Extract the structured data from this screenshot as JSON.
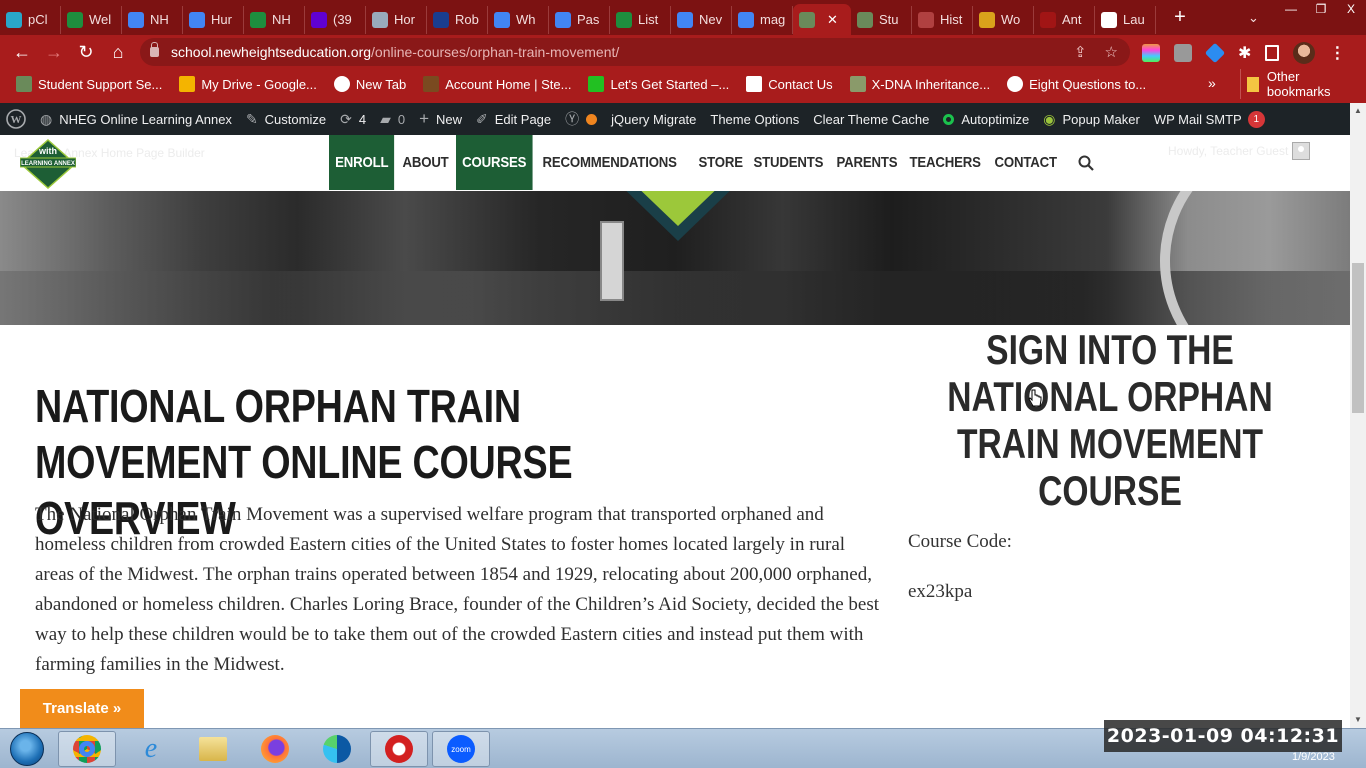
{
  "browser": {
    "tabs": [
      {
        "label": "pCl",
        "icon": "cloud-icon",
        "color": "#2aa7c9"
      },
      {
        "label": "Wel",
        "icon": "google-sheets-icon",
        "color": "#1e8e3e"
      },
      {
        "label": "NH",
        "icon": "google-docs-icon",
        "color": "#4285f4"
      },
      {
        "label": "Hur",
        "icon": "google-docs-icon",
        "color": "#4285f4"
      },
      {
        "label": "NH",
        "icon": "google-sheets-icon",
        "color": "#1e8e3e"
      },
      {
        "label": "(39",
        "icon": "yahoo-mail-icon",
        "color": "#6001d2"
      },
      {
        "label": "Hor",
        "icon": "globe-gray-icon",
        "color": "#9ab"
      },
      {
        "label": "Rob",
        "icon": "sl-icon",
        "color": "#1a3d8f"
      },
      {
        "label": "Wh",
        "icon": "google-docs-icon",
        "color": "#4285f4"
      },
      {
        "label": "Pas",
        "icon": "google-docs-icon",
        "color": "#4285f4"
      },
      {
        "label": "List",
        "icon": "google-sheets-icon",
        "color": "#1e8e3e"
      },
      {
        "label": "Nev",
        "icon": "google-docs-icon",
        "color": "#4285f4"
      },
      {
        "label": "mag",
        "icon": "google-docs-icon",
        "color": "#4285f4"
      },
      {
        "label": "",
        "icon": "tree-icon",
        "color": "#6a8a5a",
        "active": true
      },
      {
        "label": "Stu",
        "icon": "tree-icon",
        "color": "#6a8a5a"
      },
      {
        "label": "Hist",
        "icon": "history-icon",
        "color": "#b04040"
      },
      {
        "label": "Wo",
        "icon": "h-icon",
        "color": "#d9a21b"
      },
      {
        "label": "Ant",
        "icon": "red-square-icon",
        "color": "#a11515"
      },
      {
        "label": "Lau",
        "icon": "globe-icon",
        "color": "#ffffff"
      }
    ],
    "new_tab": "+",
    "tab_search": "⌄",
    "window_controls": {
      "minimize": "—",
      "restore": "❐",
      "close": "X"
    },
    "url_host": "school.newheightseducation.org",
    "url_path": "/online-courses/orphan-train-movement/",
    "bookmarks": [
      {
        "label": "Student Support Se...",
        "icon": "tree-icon"
      },
      {
        "label": "My Drive - Google...",
        "icon": "google-drive-icon"
      },
      {
        "label": "New Tab",
        "icon": "globe-icon"
      },
      {
        "label": "Account Home | Ste...",
        "icon": "account-icon"
      },
      {
        "label": "Let's Get Started –...",
        "icon": "green-square-icon"
      },
      {
        "label": "Contact Us",
        "icon": "page-icon"
      },
      {
        "label": "X-DNA Inheritance...",
        "icon": "dna-icon"
      },
      {
        "label": "Eight Questions to...",
        "icon": "globe-icon"
      }
    ],
    "more_bookmarks": "»",
    "other_bookmarks": "Other bookmarks"
  },
  "adminbar": {
    "site_name": "NHEG Online Learning Annex",
    "customize": "Customize",
    "updates_count": "4",
    "comments_count": "0",
    "new": "New",
    "edit_page": "Edit Page",
    "jquery_migrate": "jQuery Migrate",
    "theme_options": "Theme Options",
    "clear_cache": "Clear Theme Cache",
    "autoptimize": "Autoptimize",
    "popup_maker": "Popup Maker",
    "wp_mail_smtp": "WP Mail SMTP",
    "smtp_badge": "1"
  },
  "site": {
    "faint_left": "Learning Annex Home Page Builder",
    "faint_right": "Howdy, Teacher Guest",
    "nav": [
      {
        "label": "ENROLL",
        "highlight": true
      },
      {
        "label": "ABOUT",
        "highlight": false
      },
      {
        "label": "COURSES",
        "highlight": true
      },
      {
        "label": "RECOMMENDATIONS",
        "highlight": false
      },
      {
        "label": "STORE",
        "highlight": false
      },
      {
        "label": "STUDENTS",
        "highlight": false
      },
      {
        "label": "PARENTS",
        "highlight": false
      },
      {
        "label": "TEACHERS",
        "highlight": false
      },
      {
        "label": "CONTACT",
        "highlight": false
      }
    ],
    "brand_green": "#1d5e35",
    "accent_lime": "#9cc83a"
  },
  "content": {
    "title": "NATIONAL ORPHAN TRAIN MOVEMENT ONLINE COURSE OVERVIEW",
    "body": "The National Orphan Train Movement was a supervised welfare program that transported orphaned and homeless children from crowded Eastern cities of the United States to foster homes located largely in rural areas of the Midwest. The orphan trains operated between 1854 and 1929, relocating about 200,000 orphaned, abandoned or homeless children. Charles Loring Brace, founder of the Children’s Aid Society, decided the best way to help these children would be to take them out of the crowded Eastern cities and instead put them with farming families in the Midwest.",
    "signin_title": "SIGN INTO THE NATIONAL ORPHAN TRAIN MOVEMENT COURSE",
    "course_code_label": "Course Code:",
    "course_code_value": "ex23kpa"
  },
  "translate_button": "Translate »",
  "taskbar": {
    "apps": [
      "chrome",
      "internet-explorer",
      "file-explorer",
      "firefox",
      "edge",
      "app-red",
      "zoom"
    ],
    "zoom_label": "zoom",
    "overlay_timestamp": "2023-01-09  04:12:31",
    "tray_date": "1/9/2023"
  }
}
